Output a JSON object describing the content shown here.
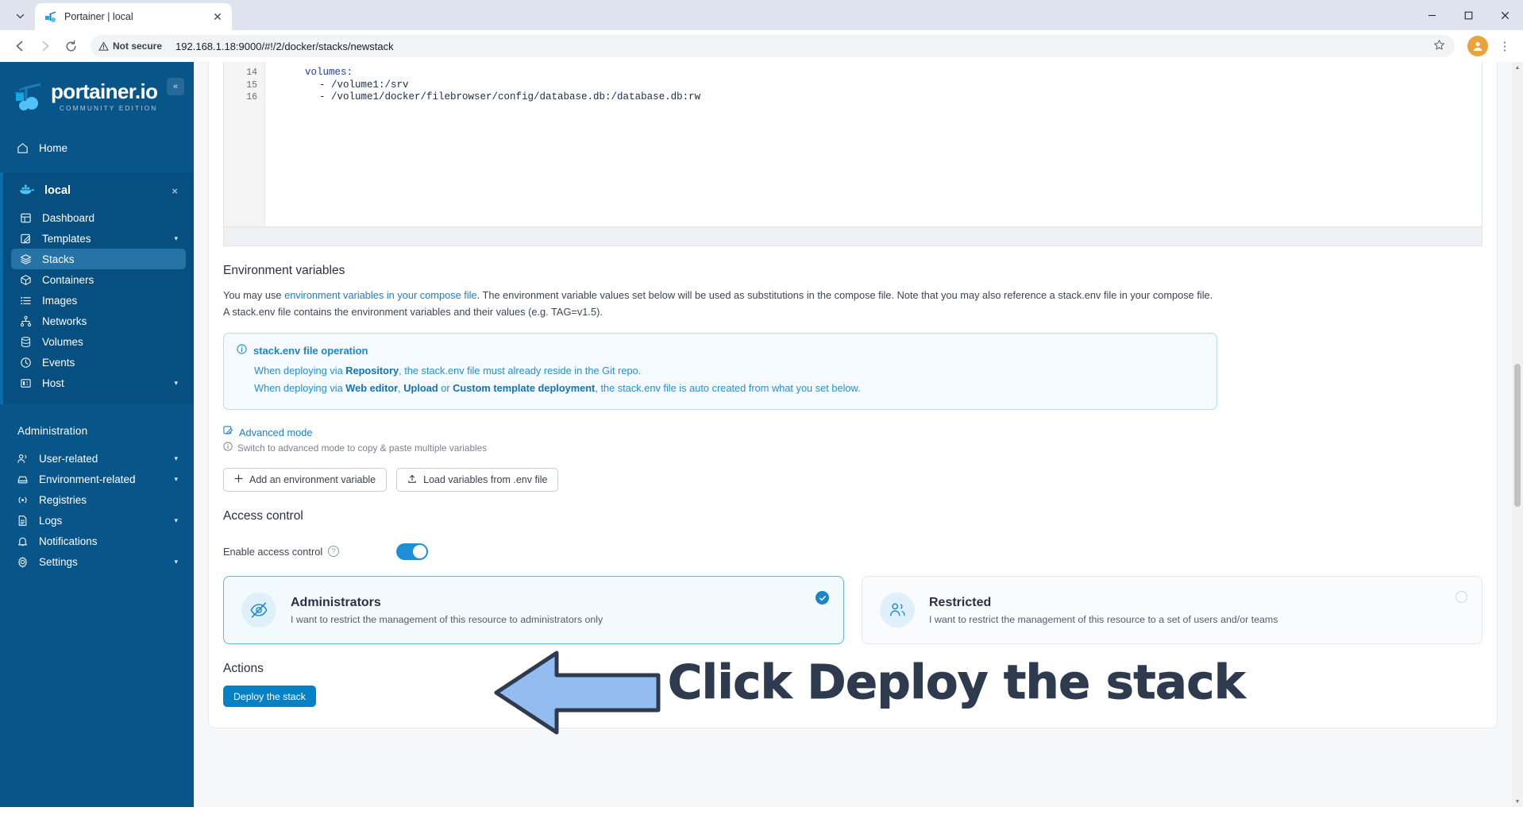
{
  "browser": {
    "tab": {
      "title": "Portainer | local",
      "favicon_icon": "portainer-favicon",
      "close_icon": "close-icon"
    },
    "tab_list_icon": "chevron-down-icon",
    "window": {
      "minimize": "—",
      "maximize": "☐",
      "close": "✕"
    },
    "nav": {
      "back_icon": "arrow-left-icon",
      "forward_icon": "arrow-right-icon",
      "reload_icon": "reload-icon"
    },
    "omnibox": {
      "security_label": "Not secure",
      "security_icon": "warning-triangle-icon",
      "url": "192.168.1.18:9000/#!/2/docker/stacks/newstack",
      "star_icon": "star-icon"
    },
    "profile_icon": "avatar",
    "menu_icon": "kebab-menu-icon"
  },
  "sidebar": {
    "logo": {
      "main": "portainer.io",
      "sub": "COMMUNITY EDITION",
      "icon": "portainer-logo-icon"
    },
    "collapse_icon": "«",
    "home": {
      "label": "Home",
      "icon": "home-icon"
    },
    "environment": {
      "label": "local",
      "icon": "docker-whale-icon",
      "close_icon": "×"
    },
    "env_items": [
      {
        "label": "Dashboard",
        "icon": "dashboard-icon",
        "chevron": ""
      },
      {
        "label": "Templates",
        "icon": "templates-icon",
        "chevron": "▾"
      },
      {
        "label": "Stacks",
        "icon": "stacks-icon",
        "chevron": "",
        "active": true
      },
      {
        "label": "Containers",
        "icon": "containers-icon",
        "chevron": ""
      },
      {
        "label": "Images",
        "icon": "images-icon",
        "chevron": ""
      },
      {
        "label": "Networks",
        "icon": "networks-icon",
        "chevron": ""
      },
      {
        "label": "Volumes",
        "icon": "volumes-icon",
        "chevron": ""
      },
      {
        "label": "Events",
        "icon": "events-clock-icon",
        "chevron": ""
      },
      {
        "label": "Host",
        "icon": "host-icon",
        "chevron": "▾"
      }
    ],
    "admin_label": "Administration",
    "admin_items": [
      {
        "label": "User-related",
        "icon": "users-icon",
        "chevron": "▾"
      },
      {
        "label": "Environment-related",
        "icon": "environment-icon",
        "chevron": "▾"
      },
      {
        "label": "Registries",
        "icon": "registries-icon",
        "chevron": ""
      },
      {
        "label": "Logs",
        "icon": "logs-icon",
        "chevron": "▾"
      },
      {
        "label": "Notifications",
        "icon": "bell-icon",
        "chevron": ""
      },
      {
        "label": "Settings",
        "icon": "gear-icon",
        "chevron": "▾"
      }
    ]
  },
  "editor": {
    "lines": [
      {
        "number": "14",
        "text": "volumes:",
        "indent": 4
      },
      {
        "number": "15",
        "text": "- /volume1:/srv",
        "indent": 6
      },
      {
        "number": "16",
        "text": "- /volume1/docker/filebrowser/config/database.db:/database.db:rw",
        "indent": 6
      }
    ]
  },
  "env_section": {
    "title": "Environment variables",
    "paragraph_pre": "You may use ",
    "paragraph_link": "environment variables in your compose file",
    "paragraph_post": ". The environment variable values set below will be used as substitutions in the compose file. Note that you may also reference a stack.env file in your compose file. A stack.env file contains the environment variables and their values (e.g. TAG=v1.5).",
    "infobox": {
      "icon": "info-circle-icon",
      "title": "stack.env file operation",
      "line1_pre": "When deploying via ",
      "line1_bold": "Repository",
      "line1_post": ", the stack.env file must already reside in the Git repo.",
      "line2_pre": "When deploying via ",
      "line2_bold1": "Web editor",
      "line2_mid1": ", ",
      "line2_bold2": "Upload",
      "line2_mid2": " or ",
      "line2_bold3": "Custom template deployment",
      "line2_post": ", the stack.env file is auto created from what you set below."
    },
    "advanced_mode": {
      "label": "Advanced mode",
      "icon": "edit-pencil-icon"
    },
    "advanced_hint": {
      "label": "Switch to advanced mode to copy & paste multiple variables",
      "icon": "info-circle-icon"
    },
    "buttons": [
      {
        "label": "Add an environment variable",
        "icon": "plus-icon"
      },
      {
        "label": "Load variables from .env file",
        "icon": "upload-icon"
      }
    ]
  },
  "access_control": {
    "title": "Access control",
    "toggle_label": "Enable access control",
    "toggle_help_icon": "question-circle-icon",
    "toggle_on": true,
    "options": [
      {
        "title": "Administrators",
        "desc": "I want to restrict the management of this resource to administrators only",
        "icon": "eye-off-icon",
        "selected": true,
        "check_icon": "check-circle-icon"
      },
      {
        "title": "Restricted",
        "desc": "I want to restrict the management of this resource to a set of users and/or teams",
        "icon": "users-group-icon",
        "selected": false,
        "check_icon": "radio-empty-icon"
      }
    ]
  },
  "actions": {
    "title": "Actions",
    "deploy_button": "Deploy the stack"
  },
  "annotation": {
    "text": "Click Deploy the stack",
    "arrow_icon": "arrow-left-annotation",
    "arrow_fill": "#93bdf0",
    "arrow_stroke": "#2e3a4e",
    "text_color": "#2e3a4e"
  },
  "colors": {
    "sidebar_bg": "#08558a",
    "sidebar_active": "#2573a7",
    "primary": "#0781c5",
    "link": "#1c7fc4",
    "info_border": "#b8dcf3"
  }
}
